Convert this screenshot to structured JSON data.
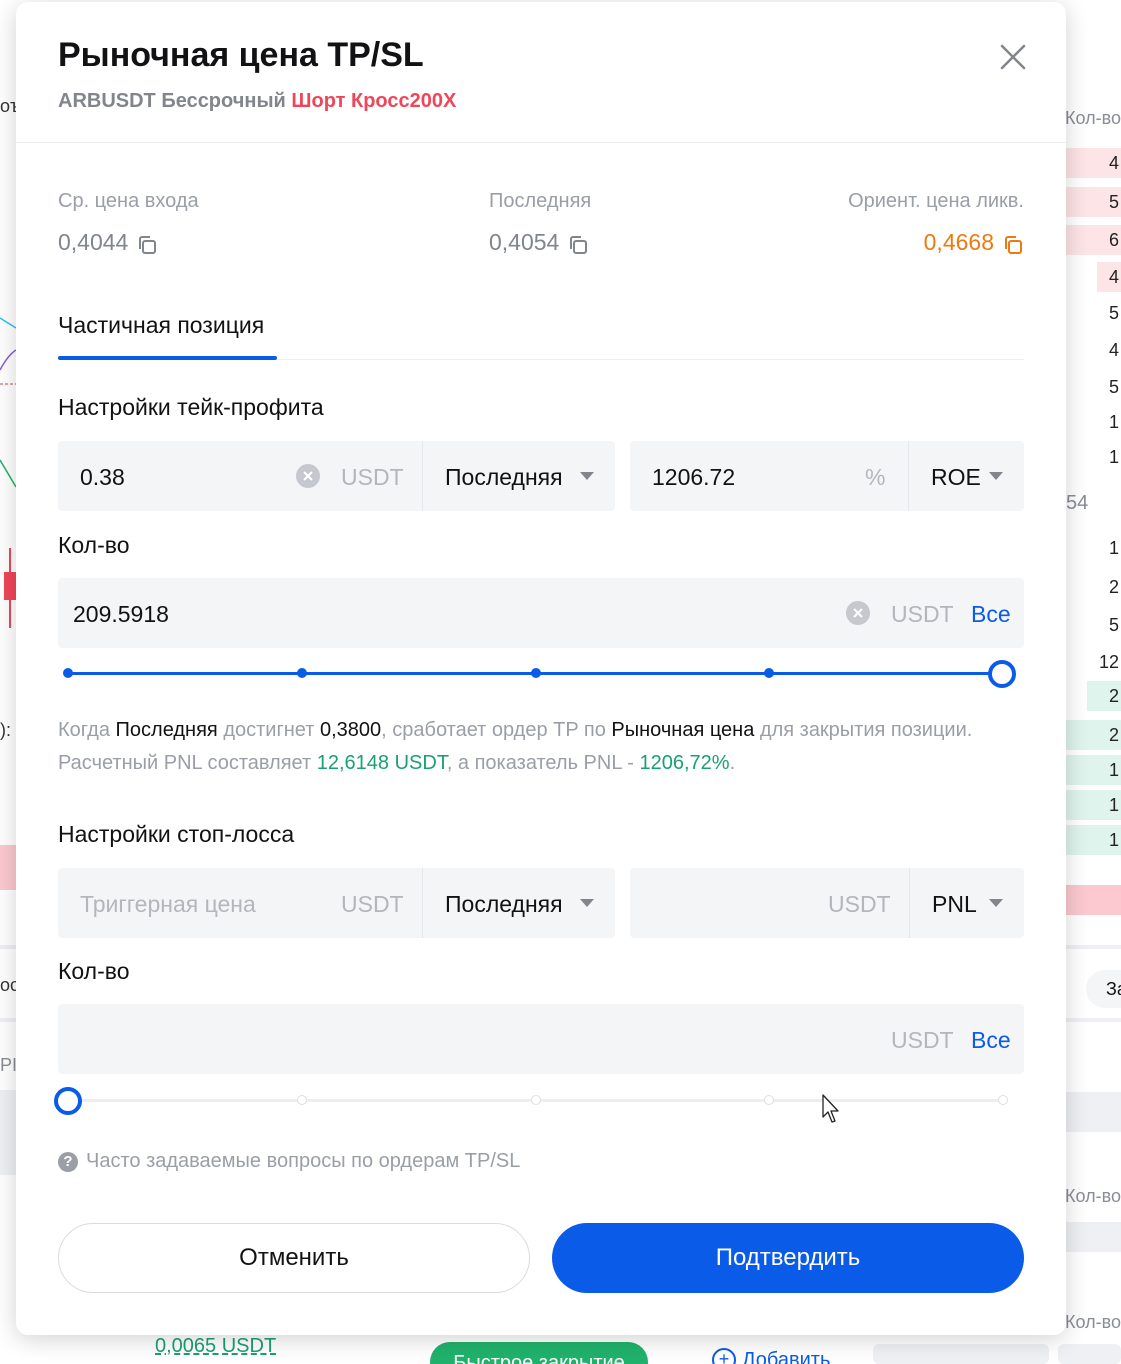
{
  "background": {
    "orderbook_header": "Кол-во",
    "orderbook_header_2": "Кол-во",
    "orderbook_header_3": "Кол-во",
    "mid_price_fragment": "54",
    "left_fragment_1": "оъ",
    "left_fragment_2": "):",
    "left_fragment_3": "ос",
    "left_fragment_4": "PI",
    "right_fragment": "За",
    "ask_rows": [
      "4",
      "5",
      "6",
      "4",
      "5",
      "4",
      "5",
      "1",
      "1"
    ],
    "bid_rows": [
      "1",
      "2",
      "5",
      "12",
      "2",
      "2",
      "1",
      "1",
      "1"
    ],
    "bottom_value": "0,0065 USDT",
    "bottom_button": "Быстрое закрытие",
    "bottom_add": "Добавить"
  },
  "modal": {
    "title": "Рыночная цена TP/SL",
    "subtitle_symbol": "ARBUSDT Бессрочный",
    "subtitle_side": "Шорт Кросс200X",
    "stats": {
      "avg_entry_label": "Ср. цена входа",
      "avg_entry_value": "0,4044",
      "last_label": "Последняя",
      "last_value": "0,4054",
      "liq_label": "Ориент. цена ликв.",
      "liq_value": "0,4668"
    },
    "tab": "Частичная позиция",
    "take_profit": {
      "title": "Настройки тейк-профита",
      "price_value": "0.38",
      "price_unit": "USDT",
      "trigger_type": "Последняя",
      "roe_value": "1206.72",
      "roe_unit": "%",
      "roe_mode": "ROE",
      "qty_label": "Кол-во",
      "qty_value": "209.5918",
      "qty_unit": "USDT",
      "qty_all": "Все",
      "slider_percent": 100
    },
    "note": {
      "p1": "Когда ",
      "trigger": "Последняя",
      "p2": " достигнет ",
      "price": "0,3800",
      "p3": ", сработает ордер TP по ",
      "order_type": "Рыночная цена",
      "p4": " для закрытия позиции.",
      "p5": "Расчетный PNL составляет ",
      "pnl": "12,6148 USDT",
      "p6": ", а показатель PNL - ",
      "pnl_pct": "1206,72%",
      "p7": "."
    },
    "stop_loss": {
      "title": "Настройки стоп-лосса",
      "price_placeholder": "Триггерная цена",
      "price_unit": "USDT",
      "trigger_type": "Последняя",
      "pnl_unit": "USDT",
      "pnl_mode": "PNL",
      "qty_label": "Кол-во",
      "qty_unit": "USDT",
      "qty_all": "Все",
      "slider_percent": 0
    },
    "faq": "Часто задаваемые вопросы по ордерам TP/SL",
    "cancel": "Отменить",
    "confirm": "Подтвердить"
  },
  "colors": {
    "accent": "#0a5be8",
    "short_red": "#f0465a",
    "liq_orange": "#ec7a10",
    "profit_green": "#1aa072"
  }
}
